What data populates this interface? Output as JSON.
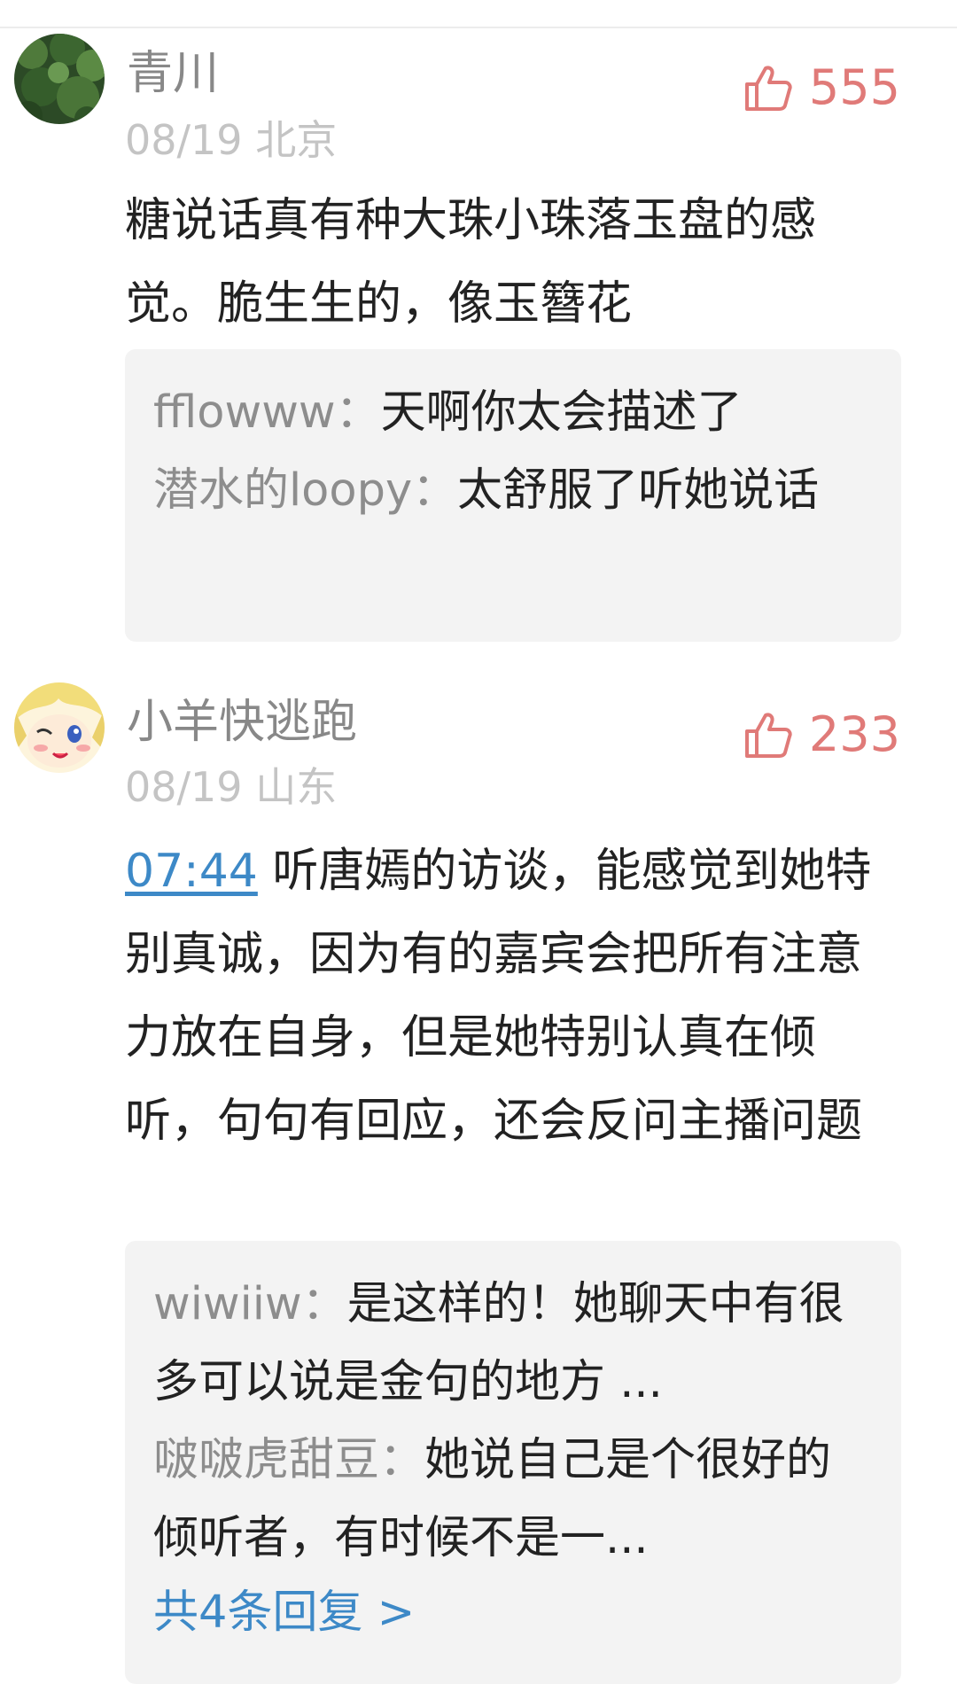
{
  "comments": [
    {
      "user": "青川",
      "date": "08/19",
      "location": "北京",
      "likes": "555",
      "text": "糖说话真有种大珠小珠落玉盘的感觉。脆生生的，像玉簪花",
      "replies": [
        {
          "user": "fflowww",
          "sep": "：",
          "text": "天啊你太会描述了"
        },
        {
          "user": "潜水的loopy",
          "sep": "：",
          "text": "太舒服了听她说话"
        }
      ]
    },
    {
      "user": "小羊快逃跑",
      "date": "08/19",
      "location": "山东",
      "likes": "233",
      "timestamp": "07:44",
      "text": " 听唐嫣的访谈，能感觉到她特别真诚，因为有的嘉宾会把所有注意力放在自身，但是她特别认真在倾听，句句有回应，还会反问主播问题",
      "replies": [
        {
          "user": "wiwiiw",
          "sep": "：",
          "text": "是这样的！她聊天中有很多可以说是金句的地方 ..."
        },
        {
          "user": "啵啵虎甜豆",
          "sep": "：",
          "text": "她说自己是个很好的倾听者，有时候不是一..."
        }
      ],
      "more_replies": "共4条回复 >"
    }
  ],
  "colors": {
    "like_red": "#e07a78",
    "link_blue": "#3d89c7",
    "username_gray": "#888888",
    "meta_gray": "#c4c4c4",
    "reply_bg": "#f3f3f3"
  }
}
